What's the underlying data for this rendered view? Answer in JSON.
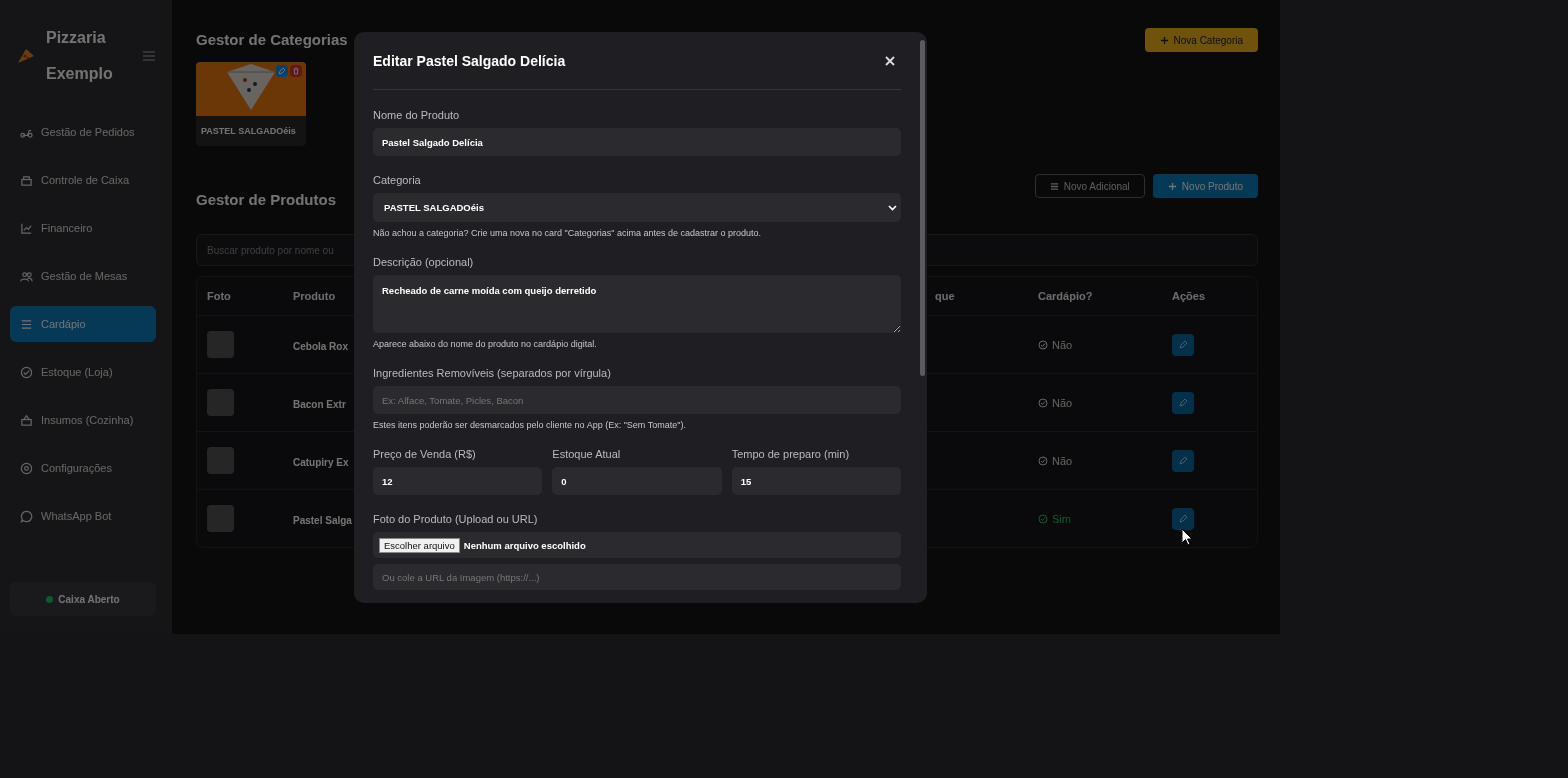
{
  "sidebar": {
    "brand": "Pizzaria Exemplo",
    "items": [
      {
        "label": "Gestão de Pedidos",
        "selected": false
      },
      {
        "label": "Controle de Caixa",
        "selected": false
      },
      {
        "label": "Financeiro",
        "selected": false
      },
      {
        "label": "Gestão de Mesas",
        "selected": false
      },
      {
        "label": "Cardápio",
        "selected": true
      },
      {
        "label": "Estoque (Loja)",
        "selected": false
      },
      {
        "label": "Insumos (Cozinha)",
        "selected": false
      },
      {
        "label": "Configurações",
        "selected": false
      },
      {
        "label": "WhatsApp Bot",
        "selected": false
      }
    ],
    "status": {
      "label": "Caixa Aberto",
      "open": true
    }
  },
  "categories": {
    "title": "Gestor de Categorias",
    "new_button": "Nova Categoria",
    "cards": [
      {
        "name": "PASTEL SALGADOéis"
      }
    ]
  },
  "products": {
    "title": "Gestor de Produtos",
    "buttons": [
      {
        "label": "Novo Adicional",
        "kind": "outline"
      },
      {
        "label": "Novo Produto",
        "kind": "primary"
      }
    ],
    "search": {
      "placeholder": "Buscar produto por nome ou"
    },
    "table": {
      "columns": [
        "Foto",
        "Produto",
        "que",
        "Cardápio?",
        "Ações"
      ],
      "rows": [
        {
          "name": "Cebola Rox",
          "menu_status": "Não",
          "on_menu": false
        },
        {
          "name": "Bacon Extr",
          "menu_status": "Não",
          "on_menu": false
        },
        {
          "name": "Catupiry Ex",
          "menu_status": "Não",
          "on_menu": false
        },
        {
          "name": "Pastel Salga",
          "menu_status": "Sim",
          "on_menu": true
        }
      ]
    }
  },
  "modal": {
    "title": "Editar Pastel Salgado Delícia",
    "fields": [
      {
        "kind": "text",
        "label": "Nome do Produto",
        "value": "Pastel Salgado Delícia"
      },
      {
        "kind": "select",
        "label": "Categoria",
        "value": "PASTEL SALGADOéis",
        "hint": "Não achou a categoria? Crie uma nova no card \"Categorias\" acima antes de cadastrar o produto."
      },
      {
        "kind": "textarea",
        "label": "Descrição (opcional)",
        "value": "Recheado de carne moída com queijo derretido",
        "hint": "Aparece abaixo do nome do produto no cardápio digital."
      },
      {
        "kind": "text",
        "label": "Ingredientes Removíveis (separados por vírgula)",
        "placeholder": "Ex: Alface, Tomate, Picles, Bacon",
        "hint": "Estes itens poderão ser desmarcados pelo cliente no App (Ex: \"Sem Tomate\")."
      },
      {
        "kind": "row",
        "fields": [
          {
            "label": "Preço de Venda (R$)",
            "value": "12"
          },
          {
            "label": "Estoque Atual",
            "value": "0"
          },
          {
            "label": "Tempo de preparo (min)",
            "value": "15"
          }
        ]
      },
      {
        "kind": "file",
        "label": "Foto do Produto (Upload ou URL)",
        "button": "Escolher arquivo",
        "status": "Nenhum arquivo escolhido",
        "placeholder": "Ou cole a URL da Imagem (https://...)"
      }
    ]
  }
}
